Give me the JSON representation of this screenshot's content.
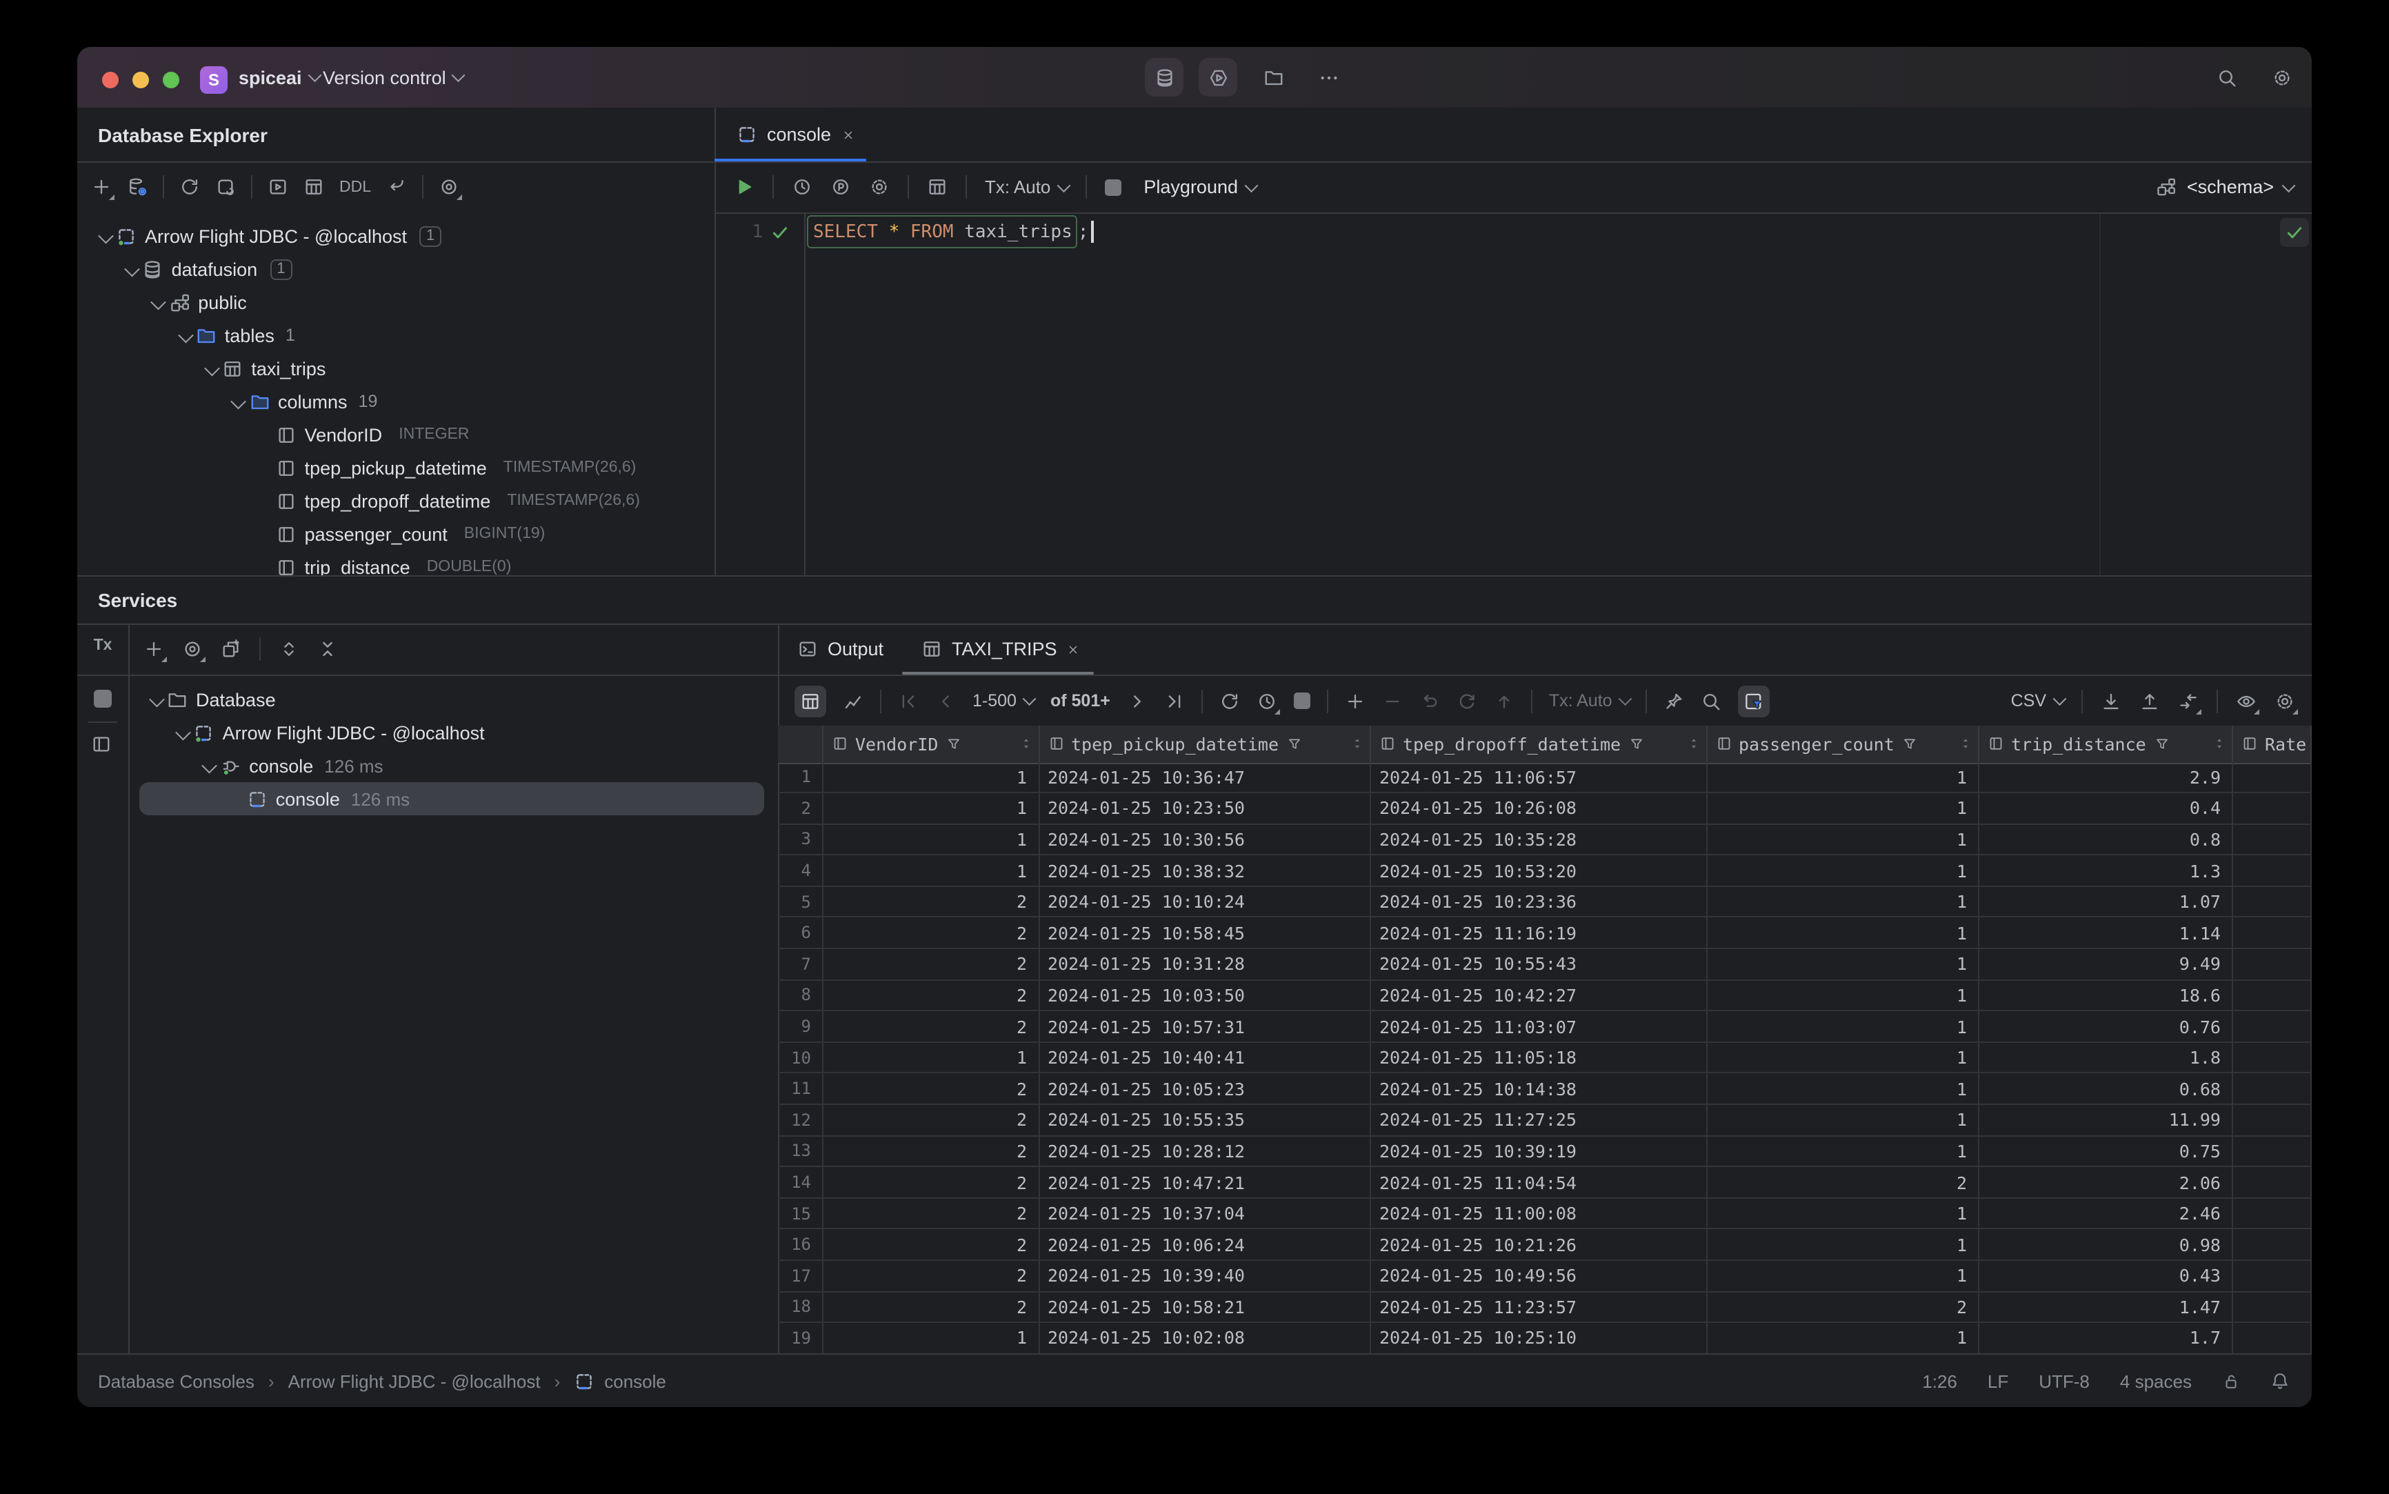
{
  "titlebar": {
    "project": "spiceai",
    "vcs": "Version control",
    "badge": "S"
  },
  "explorer": {
    "title": "Database Explorer",
    "toolbar": {
      "ddl": "DDL"
    },
    "tree": [
      {
        "label": "Arrow Flight JDBC - @localhost",
        "badge": "1",
        "level": 0,
        "icon": "datasource-icon",
        "expanded": true
      },
      {
        "label": "datafusion",
        "badge": "1",
        "level": 1,
        "icon": "database-icon",
        "expanded": true
      },
      {
        "label": "public",
        "level": 2,
        "icon": "schema-icon",
        "expanded": true
      },
      {
        "label": "tables",
        "count": "1",
        "level": 3,
        "icon": "folder-icon",
        "expanded": true
      },
      {
        "label": "taxi_trips",
        "level": 4,
        "icon": "table-icon",
        "expanded": true
      },
      {
        "label": "columns",
        "count": "19",
        "level": 5,
        "icon": "folder-icon",
        "expanded": true
      },
      {
        "label": "VendorID",
        "type": "INTEGER",
        "level": 6,
        "icon": "column-icon"
      },
      {
        "label": "tpep_pickup_datetime",
        "type": "TIMESTAMP(26,6)",
        "level": 6,
        "icon": "column-icon"
      },
      {
        "label": "tpep_dropoff_datetime",
        "type": "TIMESTAMP(26,6)",
        "level": 6,
        "icon": "column-icon"
      },
      {
        "label": "passenger_count",
        "type": "BIGINT(19)",
        "level": 6,
        "icon": "column-icon"
      },
      {
        "label": "trip_distance",
        "type": "DOUBLE(0)",
        "level": 6,
        "icon": "column-icon"
      }
    ]
  },
  "editor": {
    "tab_label": "console",
    "toolbar": {
      "tx": "Tx: Auto",
      "playground": "Playground",
      "schema": "<schema>"
    },
    "gutter_line": "1",
    "sql": {
      "kw_select": "SELECT",
      "star": "*",
      "kw_from": "FROM",
      "table": "taxi_trips",
      "semicolon": ";"
    }
  },
  "services": {
    "title": "Services",
    "strip_tx": "Tx",
    "tree": [
      {
        "label": "Database",
        "level": 0,
        "icon": "folder-outline-icon",
        "expanded": true
      },
      {
        "label": "Arrow Flight JDBC - @localhost",
        "level": 1,
        "icon": "datasource-icon",
        "expanded": true
      },
      {
        "label": "console",
        "meta": "126 ms",
        "level": 2,
        "icon": "connection-icon",
        "expanded": true
      },
      {
        "label": "console",
        "meta": "126 ms",
        "level": 3,
        "icon": "console-file-icon",
        "selected": true
      }
    ]
  },
  "results": {
    "tabs": [
      {
        "label": "Output",
        "icon": "terminal-icon"
      },
      {
        "label": "TAXI_TRIPS",
        "icon": "table-icon",
        "active": true,
        "closable": true
      }
    ],
    "toolbar": {
      "range": "1-500",
      "total": "of 501+",
      "tx": "Tx: Auto",
      "format": "CSV"
    },
    "grid": {
      "columns": [
        {
          "label": "VendorID",
          "align": "right",
          "filter": true,
          "sort": true
        },
        {
          "label": "tpep_pickup_datetime",
          "align": "left",
          "filter": true,
          "sort": true
        },
        {
          "label": "tpep_dropoff_datetime",
          "align": "left",
          "filter": true,
          "sort": true
        },
        {
          "label": "passenger_count",
          "align": "right",
          "filter": true,
          "sort": true
        },
        {
          "label": "trip_distance",
          "align": "right",
          "filter": true,
          "sort": true
        },
        {
          "label": "Rate",
          "align": "right",
          "filter": false,
          "sort": false
        }
      ],
      "rows": [
        [
          "1",
          "2024-01-25 10:36:47",
          "2024-01-25 11:06:57",
          "1",
          "2.9",
          ""
        ],
        [
          "1",
          "2024-01-25 10:23:50",
          "2024-01-25 10:26:08",
          "1",
          "0.4",
          ""
        ],
        [
          "1",
          "2024-01-25 10:30:56",
          "2024-01-25 10:35:28",
          "1",
          "0.8",
          ""
        ],
        [
          "1",
          "2024-01-25 10:38:32",
          "2024-01-25 10:53:20",
          "1",
          "1.3",
          ""
        ],
        [
          "2",
          "2024-01-25 10:10:24",
          "2024-01-25 10:23:36",
          "1",
          "1.07",
          ""
        ],
        [
          "2",
          "2024-01-25 10:58:45",
          "2024-01-25 11:16:19",
          "1",
          "1.14",
          ""
        ],
        [
          "2",
          "2024-01-25 10:31:28",
          "2024-01-25 10:55:43",
          "1",
          "9.49",
          ""
        ],
        [
          "2",
          "2024-01-25 10:03:50",
          "2024-01-25 10:42:27",
          "1",
          "18.6",
          ""
        ],
        [
          "2",
          "2024-01-25 10:57:31",
          "2024-01-25 11:03:07",
          "1",
          "0.76",
          ""
        ],
        [
          "1",
          "2024-01-25 10:40:41",
          "2024-01-25 11:05:18",
          "1",
          "1.8",
          ""
        ],
        [
          "2",
          "2024-01-25 10:05:23",
          "2024-01-25 10:14:38",
          "1",
          "0.68",
          ""
        ],
        [
          "2",
          "2024-01-25 10:55:35",
          "2024-01-25 11:27:25",
          "1",
          "11.99",
          ""
        ],
        [
          "2",
          "2024-01-25 10:28:12",
          "2024-01-25 10:39:19",
          "1",
          "0.75",
          ""
        ],
        [
          "2",
          "2024-01-25 10:47:21",
          "2024-01-25 11:04:54",
          "2",
          "2.06",
          ""
        ],
        [
          "2",
          "2024-01-25 10:37:04",
          "2024-01-25 11:00:08",
          "1",
          "2.46",
          ""
        ],
        [
          "2",
          "2024-01-25 10:06:24",
          "2024-01-25 10:21:26",
          "1",
          "0.98",
          ""
        ],
        [
          "2",
          "2024-01-25 10:39:40",
          "2024-01-25 10:49:56",
          "1",
          "0.43",
          ""
        ],
        [
          "2",
          "2024-01-25 10:58:21",
          "2024-01-25 11:23:57",
          "2",
          "1.47",
          ""
        ],
        [
          "1",
          "2024-01-25 10:02:08",
          "2024-01-25 10:25:10",
          "1",
          "1.7",
          ""
        ]
      ]
    }
  },
  "status": {
    "crumb1": "Database Consoles",
    "crumb2": "Arrow Flight JDBC - @localhost",
    "crumb3": "console",
    "caret_pos": "1:26",
    "line_ending": "LF",
    "encoding": "UTF-8",
    "indent": "4 spaces"
  },
  "colors": {
    "accent_blue": "#3574f0",
    "icon_blue": "#548af7",
    "play_green": "#5fad65",
    "keyword_orange": "#cf8e6d",
    "star_yellow": "#f2c55c",
    "panel_bg": "#1e1f22"
  }
}
